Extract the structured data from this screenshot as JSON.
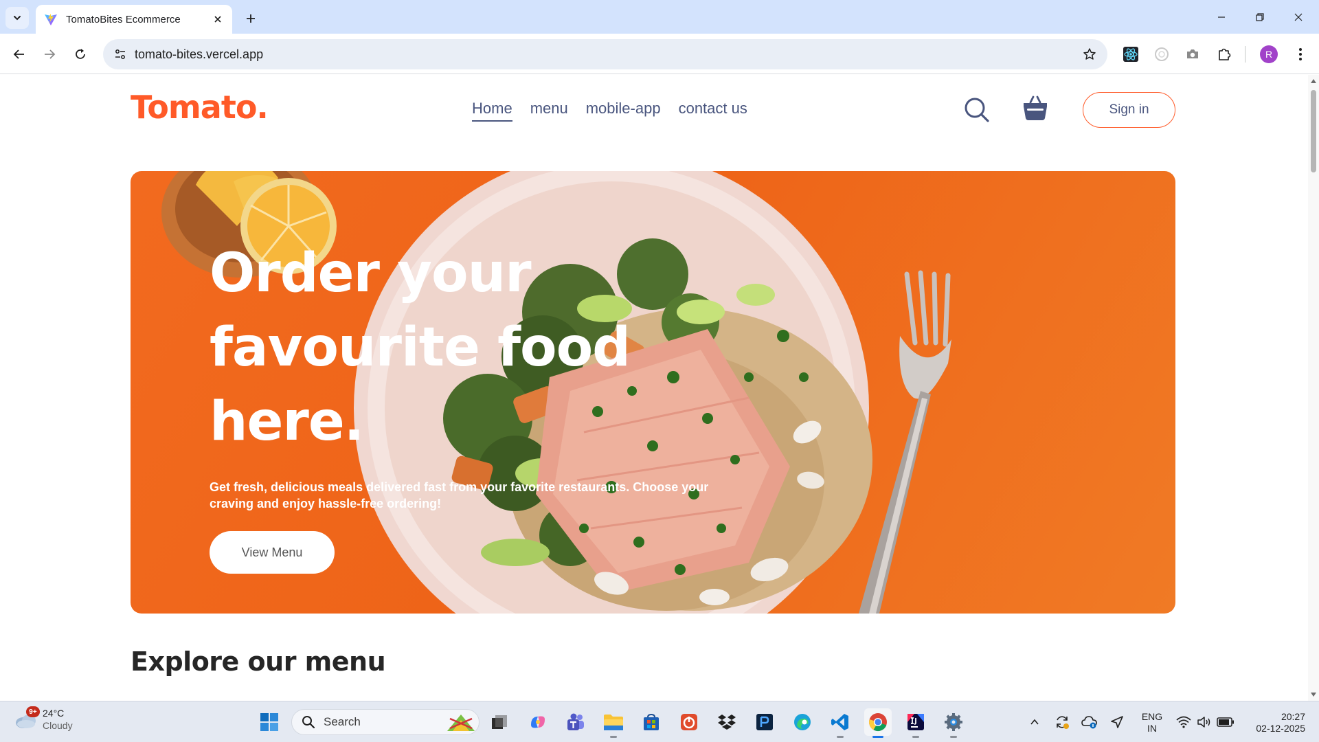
{
  "browser": {
    "tab_title": "TomatoBites Ecommerce",
    "url": "tomato-bites.vercel.app",
    "profile_initial": "R",
    "icons": [
      "tab-search-chevron",
      "vite-favicon",
      "close",
      "plus",
      "minimize",
      "restore",
      "close-window",
      "back-arrow",
      "forward-arrow",
      "reload",
      "site-info",
      "star",
      "react-devtools",
      "extension-circle",
      "camera",
      "puzzle",
      "kebab-menu"
    ]
  },
  "site": {
    "logo": "Tomato.",
    "nav": [
      {
        "label": "Home",
        "active": true
      },
      {
        "label": "menu",
        "active": false
      },
      {
        "label": "mobile-app",
        "active": false
      },
      {
        "label": "contact us",
        "active": false
      }
    ],
    "sign_in": "Sign in",
    "icons": [
      "search",
      "basket"
    ],
    "colors": {
      "brand": "#ff5a28",
      "hero_bg": "#ee6418",
      "nav_text": "#49557e"
    }
  },
  "hero": {
    "title_lines": [
      "Order your",
      "favourite food",
      "here."
    ],
    "subtitle": "Get fresh, delicious meals delivered fast from your favorite restaurants. Choose your craving and enjoy hassle-free ordering!",
    "cta": "View Menu"
  },
  "section": {
    "title": "Explore our menu"
  },
  "taskbar": {
    "weather": {
      "temp": "24°C",
      "condition": "Cloudy",
      "badge": "9+"
    },
    "search_label": "Search",
    "apps": [
      "windows-start",
      "file-explorer-app",
      "copilot",
      "teams",
      "folder",
      "microsoft-store",
      "office",
      "dropbox",
      "app-dark",
      "edge",
      "vs-code",
      "chrome",
      "intellij",
      "settings"
    ],
    "tray": {
      "lang_top": "ENG",
      "lang_bottom": "IN",
      "time": "20:27",
      "date": "02-12-2025"
    }
  }
}
